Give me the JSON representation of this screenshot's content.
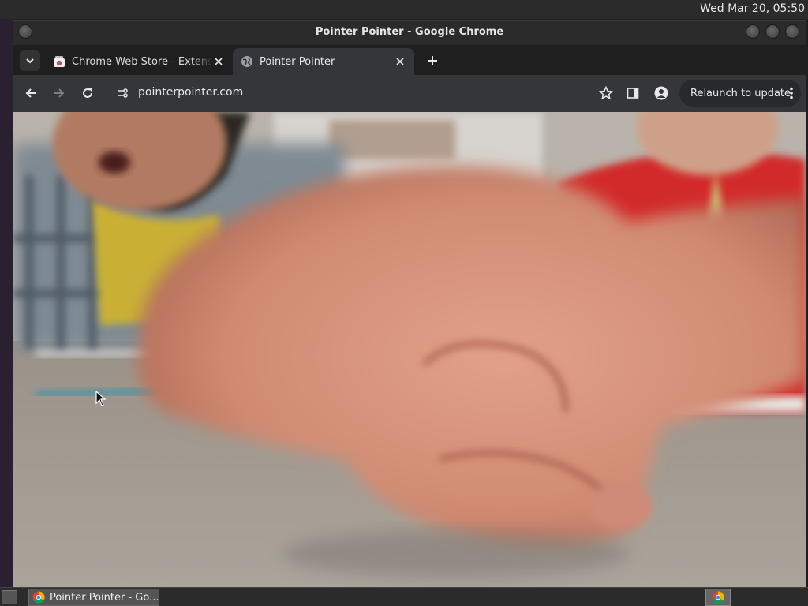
{
  "desktop": {
    "clock": "Wed Mar 20, 05:50"
  },
  "window": {
    "title": "Pointer Pointer - Google Chrome"
  },
  "tabs": [
    {
      "label": "Chrome Web Store - Extensions",
      "active": false,
      "favicon": "web-store-icon"
    },
    {
      "label": "Pointer Pointer",
      "active": true,
      "favicon": "globe-icon"
    }
  ],
  "toolbar": {
    "url": "pointerpointer.com",
    "relaunch_label": "Relaunch to update"
  },
  "content": {
    "description_icon": "photo-of-finger-pointing"
  },
  "taskbar": {
    "chrome_task_label": "Pointer Pointer - Go..."
  },
  "colors": {
    "accent": "#35363a",
    "tabstrip": "#1f1f1f",
    "shirt": "#d8262a"
  }
}
